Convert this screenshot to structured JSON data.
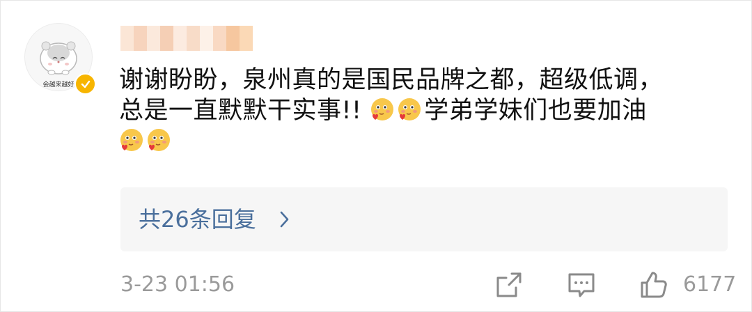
{
  "avatar": {
    "caption": "会越来越好"
  },
  "comment": {
    "line1": "谢谢盼盼，泉州真的是国民品牌之都，超级低调，",
    "line2_text": "总是一直默默干实事!!",
    "line2_after_emoji": "学弟学妹们也要加油",
    "emoji_name": "blush-heart-emoji"
  },
  "replies": {
    "label": "共26条回复"
  },
  "footer": {
    "timestamp": "3-23 01:56",
    "like_count": "6177"
  },
  "colors": {
    "link": "#4a6f9c",
    "muted": "#9a9a9a",
    "verified": "#f7b500"
  }
}
